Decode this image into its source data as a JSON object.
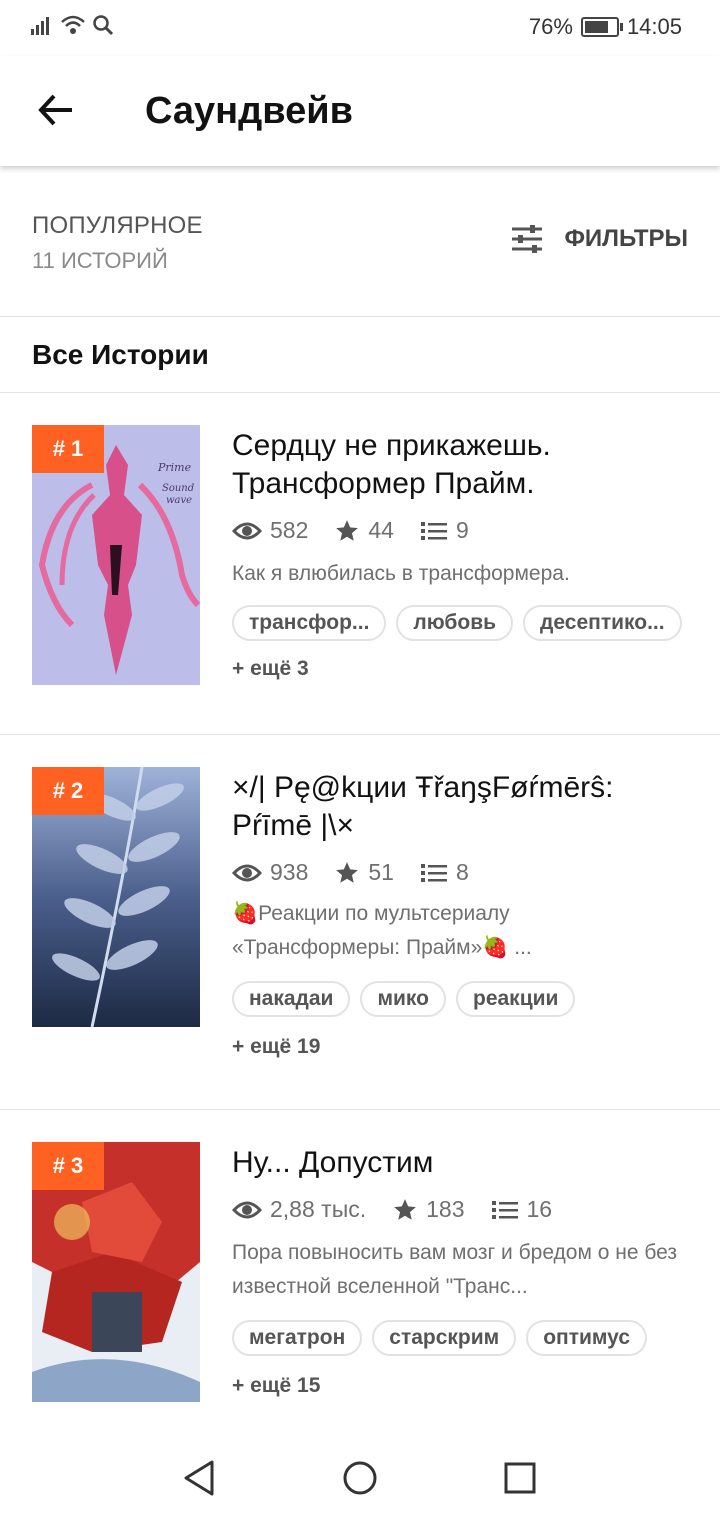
{
  "status_bar": {
    "battery": "76%",
    "time": "14:05",
    "battery_level": 0.76
  },
  "app_bar": {
    "title": "Саундвейв",
    "back_icon": "arrow-back-icon"
  },
  "sort": {
    "label": "ПОПУЛЯРНОЕ",
    "count": "11 ИСТОРИЙ",
    "filters_label": "ФИЛЬТРЫ"
  },
  "section": {
    "title": "Все Истории"
  },
  "stories": [
    {
      "rank": "# 1",
      "title": "Сердцу не прикажешь. Трансформер Прайм.",
      "views": "582",
      "votes": "44",
      "parts": "9",
      "description": "Как я влюбилась в трансформера.",
      "tags": [
        "трансфор...",
        "любовь",
        "десептико..."
      ],
      "more": "+ ещё 3",
      "cover_color": "#b8b8e8",
      "cover_text": "Prime Sound wave"
    },
    {
      "rank": "# 2",
      "title": "×/| Pę@kции ŦřaŋşFøŕmērŝ: Pŕīmē |\\×",
      "views": "938",
      "votes": "51",
      "parts": "8",
      "description": "🍓Реакции по мультсериалу «Трансформеры: Прайм»🍓 ...",
      "tags": [
        "накадаи",
        "мико",
        "реакции"
      ],
      "more": "+ ещё 19",
      "cover_color": "#3c4d76"
    },
    {
      "rank": "# 3",
      "title": "Ну... Допустим",
      "views": "2,88 тыс.",
      "votes": "183",
      "parts": "16",
      "description": "Пора повыносить вам мозг и бредом о не без известной вселенной \"Транс...",
      "tags": [
        "мегатрон",
        "старскрим",
        "оптимус"
      ],
      "more": "+ ещё 15",
      "cover_color": "#c6302a"
    }
  ],
  "colors": {
    "accent": "#ff6122",
    "text": "#121212",
    "muted": "#6f6f6f"
  }
}
